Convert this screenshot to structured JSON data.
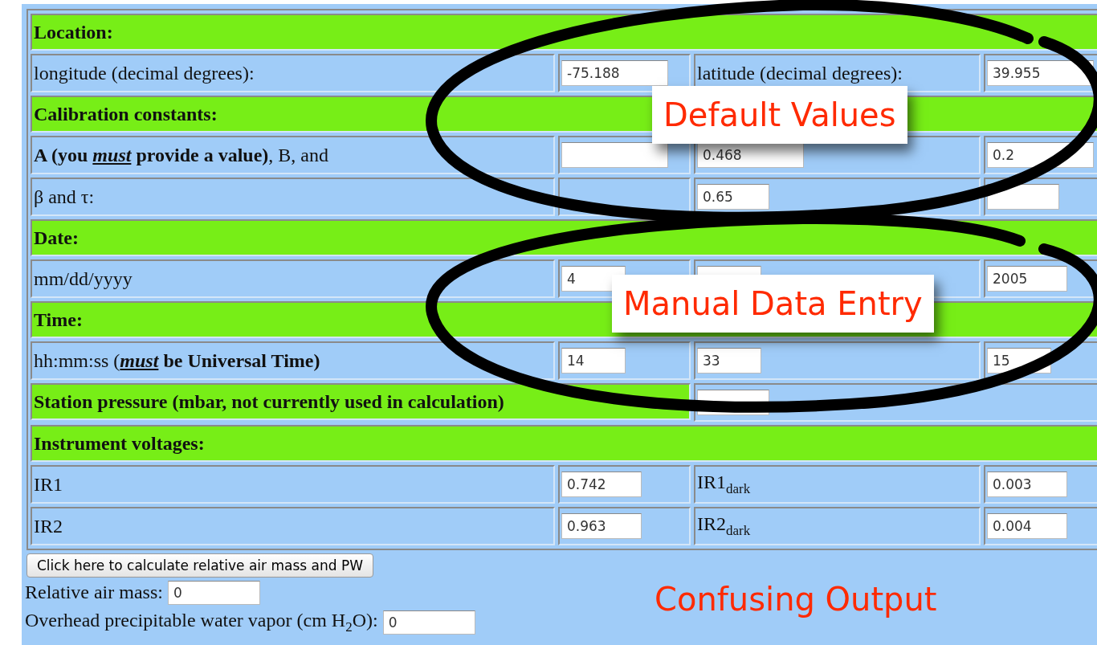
{
  "sections": [
    {
      "heading": "Location:",
      "rows": [
        {
          "cells": [
            {
              "kind": "label",
              "text": "longitude (decimal degrees):"
            },
            {
              "kind": "widefield",
              "value": "-75.188"
            },
            {
              "kind": "label",
              "text": "latitude (decimal degrees):"
            },
            {
              "kind": "widefield",
              "value": "39.955"
            }
          ]
        }
      ]
    },
    {
      "heading": "Calibration constants:",
      "rows": [
        {
          "cells": [
            {
              "kind": "label",
              "text": "**A (you *must* provide a value)**, B, and"
            },
            {
              "kind": "widefield"
            },
            {
              "kind": "widefield",
              "value": "0.468"
            },
            {
              "kind": "widefield",
              "value": "0.2"
            }
          ]
        },
        {
          "cells": [
            {
              "kind": "label",
              "text": "β and τ:"
            },
            {
              "kind": "blank"
            },
            {
              "kind": "narrowfield",
              "value": "0.65"
            },
            {
              "kind": "narrowfield"
            }
          ]
        }
      ]
    },
    {
      "heading": "Date:",
      "rows": [
        {
          "cells": [
            {
              "kind": "label",
              "text": "mm/dd/yyyy"
            },
            {
              "kind": "shortfield",
              "value": "4"
            },
            {
              "kind": "shortfield"
            },
            {
              "kind": "field",
              "value": "2005"
            }
          ]
        }
      ]
    },
    {
      "heading": "Time:",
      "rows": [
        {
          "cells": [
            {
              "kind": "label",
              "text": "hh:mm:ss (***must* be Universal Time)**"
            },
            {
              "kind": "shortfield",
              "value": "14"
            },
            {
              "kind": "shortfield",
              "value": "33"
            },
            {
              "kind": "shortfield",
              "value": "15"
            }
          ]
        },
        {
          "cells": [
            {
              "kind": "heading",
              "text": "Station pressure (mbar, not currently used in calculation)"
            },
            {
              "kind": "narrowfield"
            }
          ]
        }
      ]
    },
    {
      "heading": "Instrument voltages:",
      "rows": [
        {
          "cells": [
            {
              "kind": "label",
              "text": "IR1"
            },
            {
              "kind": "field",
              "value": "0.742"
            },
            {
              "kind": "label",
              "text": "IR1$_{dark}$"
            },
            {
              "kind": "field",
              "value": "0.003"
            }
          ]
        },
        {
          "cells": [
            {
              "kind": "label",
              "text": "IR2"
            },
            {
              "kind": "field",
              "value": "0.963"
            },
            {
              "kind": "label",
              "text": "IR2$_{dark}$"
            },
            {
              "kind": "field",
              "value": "0.004"
            }
          ]
        }
      ]
    }
  ],
  "calculate_button": "Click here to calculate relative air mass and PW",
  "outputs": [
    {
      "label": "Relative air mass:",
      "value": "0"
    },
    {
      "label": "Overhead precipitable water vapor (cm H$_{2}$O):",
      "value": "0"
    }
  ],
  "annotations": [
    {
      "kind": "boxed",
      "text": "Default Values"
    },
    {
      "kind": "boxed",
      "text": "Manual Data Entry"
    },
    {
      "kind": "plain",
      "text": "Confusing Output"
    }
  ]
}
